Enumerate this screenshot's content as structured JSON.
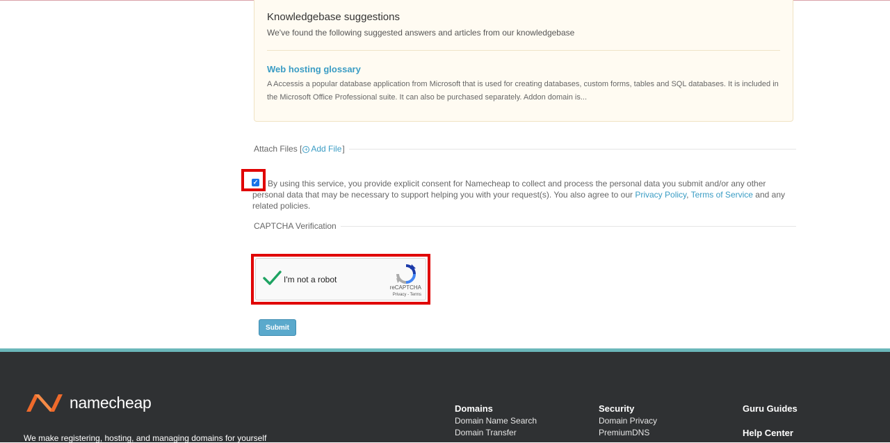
{
  "kb": {
    "title": "Knowledgebase suggestions",
    "subtitle": "We've found the following suggested answers and articles from our knowledgebase",
    "article": {
      "title": "Web hosting glossary",
      "excerpt": "A Accessis a popular database application from Microsoft that is used for creating databases, custom forms, tables and SQL databases. It is included in the Microsoft Office Professional suite. It can also be purchased separately. Addon domain is..."
    }
  },
  "attach": {
    "label_prefix": "Attach Files [",
    "add_file": "Add File",
    "label_suffix": "]"
  },
  "consent": {
    "text_before": "By using this service, you provide explicit consent for Namecheap to collect and process the personal data you submit and/or any other personal data that may be necessary to support helping you with your request(s). You also agree to our ",
    "privacy_policy": "Privacy Policy",
    "comma": ", ",
    "terms": "Terms of Service",
    "text_after": " and any related policies."
  },
  "captcha": {
    "heading": "CAPTCHA Verification",
    "label": "I'm not a robot",
    "brand": "reCAPTCHA",
    "terms": "Privacy - Terms"
  },
  "submit_label": "Submit",
  "footer": {
    "brand": "namecheap",
    "tagline": "We make registering, hosting, and managing domains for yourself",
    "columns": [
      {
        "heading": "Domains",
        "items": [
          "Domain Name Search",
          "Domain Transfer"
        ]
      },
      {
        "heading": "Security",
        "items": [
          "Domain Privacy",
          "PremiumDNS"
        ]
      }
    ],
    "guru_guides": "Guru Guides",
    "help_center": "Help Center"
  },
  "colors": {
    "link": "#3a9cc4",
    "highlight": "#e00000",
    "footer_bg": "#2f3133",
    "footer_accent": "#6bb7ba",
    "brand_orange": "#ee6a2b"
  }
}
